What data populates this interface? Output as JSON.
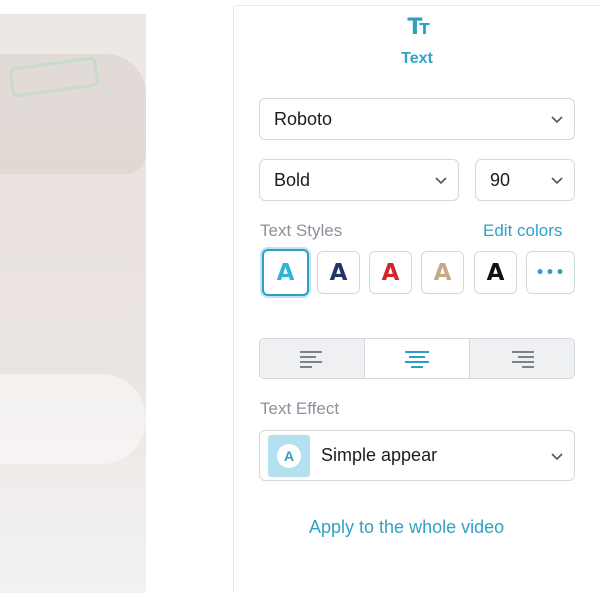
{
  "panel": {
    "title": "Text",
    "icon": "text-tt-icon",
    "accent_color": "#2f9fc1"
  },
  "font": {
    "family": "Roboto",
    "weight": "Bold",
    "size": "90"
  },
  "text_styles": {
    "label": "Text Styles",
    "edit_link": "Edit colors",
    "styles": [
      {
        "glyph": "A",
        "color": "#2fb3dd",
        "active": true
      },
      {
        "glyph": "A",
        "color": "#23346b"
      },
      {
        "glyph": "A",
        "color": "#d2262b"
      },
      {
        "glyph": "A",
        "color": "#c7a987"
      },
      {
        "glyph": "A",
        "color": "#111111"
      }
    ],
    "more": "•••"
  },
  "alignment": {
    "options": [
      "align-left",
      "align-center",
      "align-right"
    ],
    "selected": "align-center"
  },
  "effect": {
    "label": "Text Effect",
    "thumb_glyph": "A",
    "value": "Simple appear"
  },
  "apply_link": "Apply to the whole video"
}
